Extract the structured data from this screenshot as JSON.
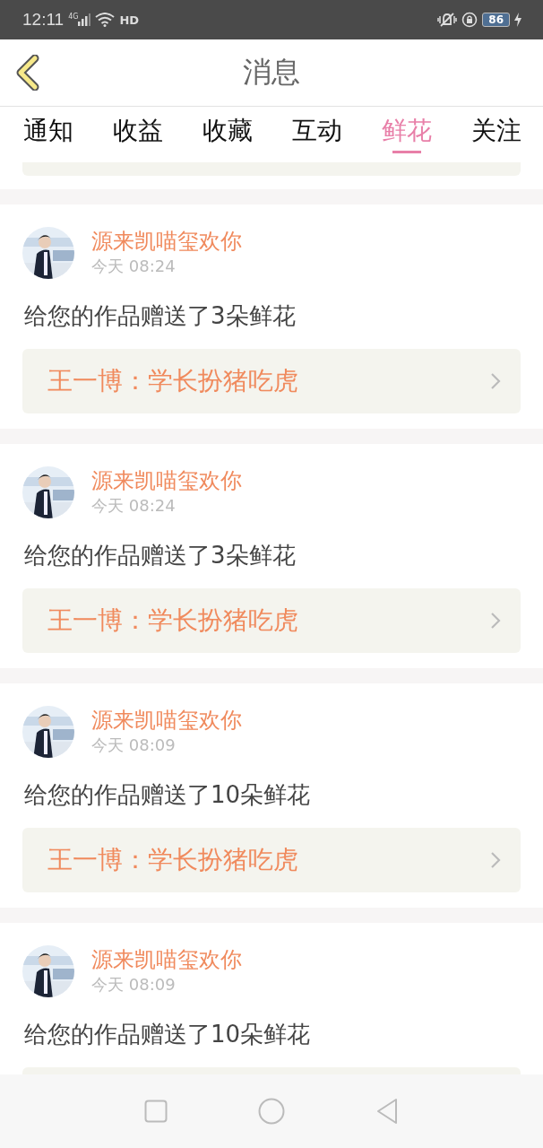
{
  "status_bar": {
    "time": "12:11",
    "network": "4G",
    "hd": "HD",
    "battery": "86"
  },
  "header": {
    "title": "消息"
  },
  "tabs": [
    {
      "label": "通知",
      "selected": false
    },
    {
      "label": "收益",
      "selected": false
    },
    {
      "label": "收藏",
      "selected": false
    },
    {
      "label": "互动",
      "selected": false
    },
    {
      "label": "鲜花",
      "selected": true
    },
    {
      "label": "关注",
      "selected": false
    }
  ],
  "messages": [
    {
      "sender": "源来凯喵玺欢你",
      "time": "今天 08:24",
      "text": "给您的作品赠送了3朵鲜花",
      "work": "王一博：学长扮猪吃虎"
    },
    {
      "sender": "源来凯喵玺欢你",
      "time": "今天 08:24",
      "text": "给您的作品赠送了3朵鲜花",
      "work": "王一博：学长扮猪吃虎"
    },
    {
      "sender": "源来凯喵玺欢你",
      "time": "今天 08:09",
      "text": "给您的作品赠送了10朵鲜花",
      "work": "王一博：学长扮猪吃虎"
    },
    {
      "sender": "源来凯喵玺欢你",
      "time": "今天 08:09",
      "text": "给您的作品赠送了10朵鲜花"
    }
  ]
}
